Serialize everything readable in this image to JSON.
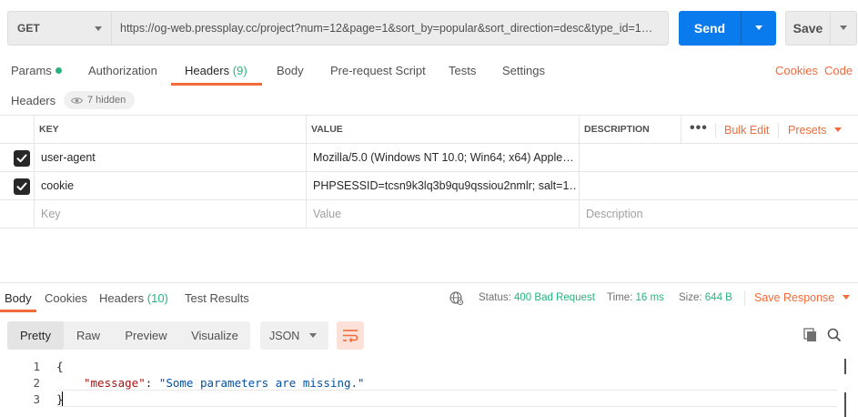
{
  "request": {
    "method": "GET",
    "url": "https://og-web.pressplay.cc/project?num=12&page=1&sort_by=popular&sort_direction=desc&type_id=1…",
    "send_label": "Send",
    "save_label": "Save"
  },
  "request_tabs": {
    "params": "Params",
    "authorization": "Authorization",
    "headers": "Headers",
    "headers_count": "(9)",
    "body": "Body",
    "prerequest": "Pre-request Script",
    "tests": "Tests",
    "settings": "Settings",
    "cookies": "Cookies",
    "code": "Code"
  },
  "headers_section": {
    "title": "Headers",
    "hidden_label": "7 hidden"
  },
  "table": {
    "columns": {
      "key": "KEY",
      "value": "VALUE",
      "description": "DESCRIPTION"
    },
    "bulk_edit": "Bulk Edit",
    "presets": "Presets",
    "rows": [
      {
        "checked": true,
        "key": "user-agent",
        "value": "Mozilla/5.0 (Windows NT 10.0; Win64; x64) Apple…",
        "description": ""
      },
      {
        "checked": true,
        "key": "cookie",
        "value": "PHPSESSID=tcsn9k3lq3b9qu9qssiou2nmlr; salt=1…",
        "description": ""
      }
    ],
    "placeholder": {
      "key": "Key",
      "value": "Value",
      "description": "Description"
    }
  },
  "response_tabs": {
    "body": "Body",
    "cookies": "Cookies",
    "headers": "Headers",
    "headers_count": "(10)",
    "test_results": "Test Results"
  },
  "response_status": {
    "status_label": "Status:",
    "status_value": "400 Bad Request",
    "time_label": "Time:",
    "time_value": "16 ms",
    "size_label": "Size:",
    "size_value": "644 B",
    "save_response": "Save Response"
  },
  "body_toolbar": {
    "modes": [
      "Pretty",
      "Raw",
      "Preview",
      "Visualize"
    ],
    "format": "JSON"
  },
  "code": {
    "line_numbers": [
      "1",
      "2",
      "3"
    ],
    "open_brace": "{",
    "key": "\"message\"",
    "colon": ": ",
    "value": "\"Some parameters are missing.\"",
    "close_brace": "}"
  },
  "colors": {
    "accent": "#f26b3a",
    "primary": "#097bed",
    "success": "#26b47f"
  }
}
